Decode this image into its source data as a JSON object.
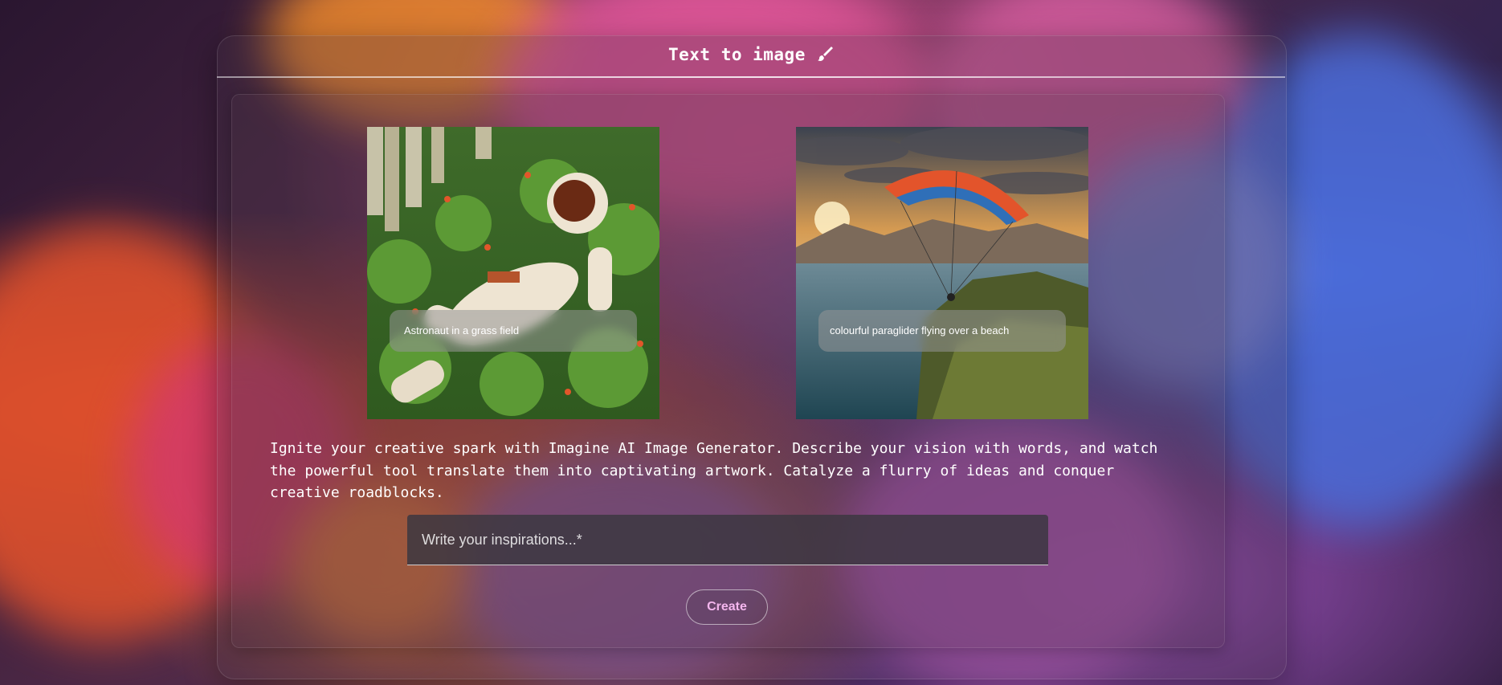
{
  "header": {
    "title": "Text to image",
    "title_icon": "paintbrush-icon"
  },
  "gallery": [
    {
      "caption": "Astronaut in a grass field"
    },
    {
      "caption": "colourful paraglider flying over a beach"
    }
  ],
  "description": "Ignite your creative spark with Imagine AI Image Generator. Describe your vision with words, and watch the powerful tool translate them into captivating artwork. Catalyze a flurry of ideas and conquer creative roadblocks.",
  "prompt": {
    "placeholder": "Write your inspirations...*",
    "value": ""
  },
  "create_button": {
    "label": "Create"
  },
  "colors": {
    "accent": "#f4b6ee",
    "text": "#ffffff"
  }
}
